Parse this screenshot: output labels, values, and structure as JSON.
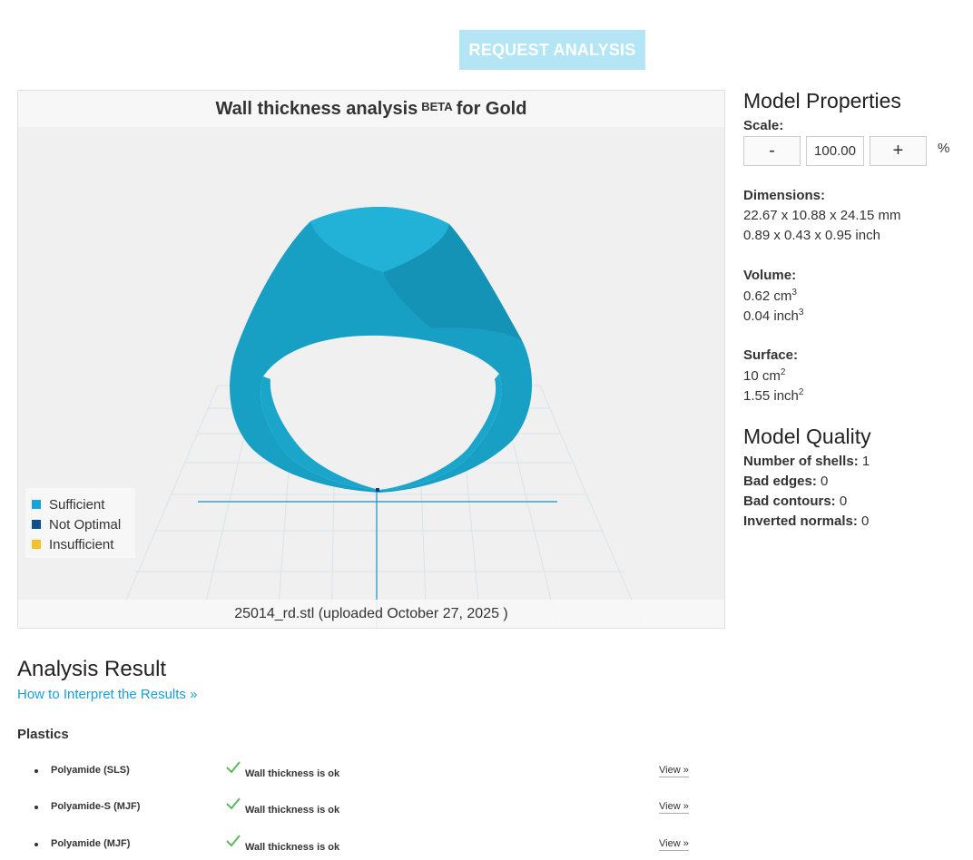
{
  "request_button": "REQUEST ANALYSIS",
  "viewer": {
    "title_prefix": "Wall thickness analysis",
    "title_sup": "BETA",
    "title_suffix": "for Gold",
    "footer": "25014_rd.stl (uploaded October 27, 2025 )",
    "legend": [
      {
        "label": "Sufficient",
        "color": "#1aa3d9"
      },
      {
        "label": "Not Optimal",
        "color": "#0b4f8f"
      },
      {
        "label": "Insufficient",
        "color": "#f2c12e"
      }
    ]
  },
  "properties": {
    "heading": "Model Properties",
    "scale_label": "Scale:",
    "scale_minus": "-",
    "scale_value": "100.00",
    "scale_plus": "+",
    "scale_unit": "%",
    "dimensions_label": "Dimensions:",
    "dimensions_mm": "22.67 x 10.88 x 24.15 mm",
    "dimensions_inch": "0.89 x 0.43 x 0.95 inch",
    "volume_label": "Volume:",
    "volume_cm": "0.62 cm",
    "volume_inch": "0.04 inch",
    "surface_label": "Surface:",
    "surface_cm": "10 cm",
    "surface_inch": "1.55 inch",
    "exp_cubic": "3",
    "exp_square": "2"
  },
  "quality": {
    "heading": "Model Quality",
    "shells_label": "Number of shells:",
    "shells_value": "1",
    "edges_label": "Bad edges:",
    "edges_value": "0",
    "contours_label": "Bad contours:",
    "contours_value": "0",
    "normals_label": "Inverted normals:",
    "normals_value": "0"
  },
  "analysis": {
    "heading": "Analysis Result",
    "link": "How to Interpret the Results »",
    "category": "Plastics",
    "rows": [
      {
        "name": "Polyamide (SLS)",
        "status": "Wall thickness is ok",
        "view": "View »"
      },
      {
        "name": "Polyamide-S (MJF)",
        "status": "Wall thickness is ok",
        "view": "View »"
      },
      {
        "name": "Polyamide (MJF)",
        "status": "Wall thickness is ok",
        "view": "View »"
      }
    ]
  }
}
